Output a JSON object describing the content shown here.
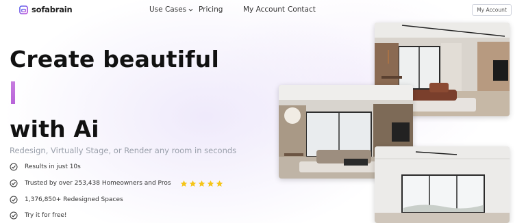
{
  "brand": {
    "name": "sofabrain",
    "logo_icon": "sofabrain-logo-icon",
    "accent": "#7b4fe0"
  },
  "nav": {
    "items": [
      {
        "label": "Use Cases",
        "has_dropdown": true
      },
      {
        "label": "Pricing"
      },
      {
        "label": "My Account"
      },
      {
        "label": "Contact"
      }
    ],
    "account_button": "My Account"
  },
  "hero": {
    "title_line1": "Create beautiful",
    "title_line2": "with Ai",
    "cursor_color": "#c070dd",
    "subtitle": "Redesign, Virtually Stage, or Render any room in seconds",
    "features": [
      {
        "text": "Results in just 10s",
        "icon": "check-circle-icon"
      },
      {
        "text": "Trusted by over 253,438 Homeowners and Pros",
        "icon": "check-circle-icon",
        "stars": 5,
        "star_color": "#f5c518"
      },
      {
        "text": "1,376,850+ Redesigned Spaces",
        "icon": "check-circle-icon"
      },
      {
        "text": "Try it for free!",
        "icon": "check-circle-icon"
      }
    ]
  },
  "gallery": {
    "images": [
      {
        "subject": "modern living room with brown sectional sofa and tv wall"
      },
      {
        "subject": "modern living room with beige sectional sofa and pendant lamp"
      },
      {
        "subject": "empty white room with large windows"
      }
    ]
  }
}
